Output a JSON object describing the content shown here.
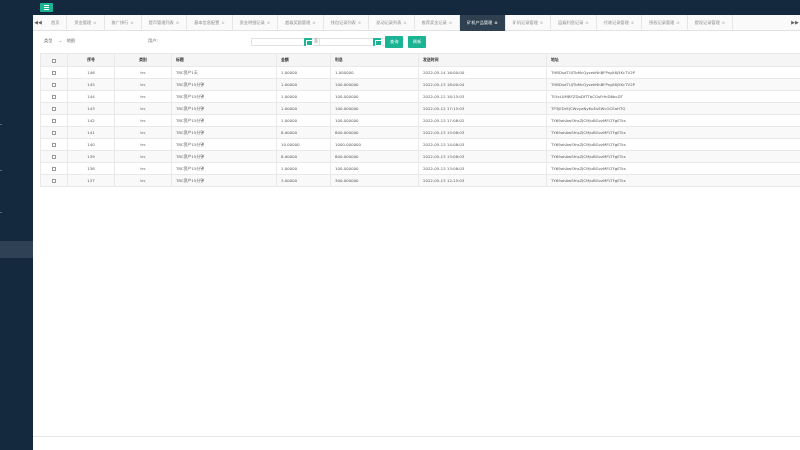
{
  "header": {
    "accent_color": "#1ab394",
    "sidebar_color": "#15293e",
    "active_tab_color": "#2f4050"
  },
  "tabs": [
    "首页",
    "资金管理",
    "推广排行",
    "提币管理列表",
    "基本信息配置",
    "资金明细记录",
    "超级奖励管理",
    "钱包记录列表",
    "发动记录列表",
    "推荐奖金记录",
    "矿机产品管理",
    "矿机记录管理",
    "层级利息记录",
    "代收记录管理",
    "授权记录管理",
    "提现记录管理"
  ],
  "active_tab_index": 10,
  "filter": {
    "type_value": "类型",
    "type_placeholder": "地图",
    "user_label": "用户:",
    "created_label": "创建时间",
    "to_label": "至",
    "search_button": "查询",
    "refresh_button": "刷新"
  },
  "table": {
    "columns": [
      "序号",
      "类别",
      "标题",
      "金额",
      "利息",
      "发送时间",
      "地址"
    ],
    "rows": [
      [
        "146",
        "trc",
        "TRC资产1天",
        "1.00000",
        "1.000000",
        "2022-05-14 16:00:00",
        "THBDsdTUJTbMcQysekNhBFPrgX6j5KcTV2P"
      ],
      [
        "145",
        "trc",
        "TRC资产15分钟",
        "1.00000",
        "100.000000",
        "2022-05-13 18:00:04",
        "THBDsdTUJTbMcQysekNhBFPrgX6j5KcTV2P"
      ],
      [
        "144",
        "trc",
        "TRC资产15分钟",
        "1.00000",
        "100.000000",
        "2022-05-12 18:15:03",
        "TLYxLUMBFZDoDfTTbCGsFrfnD6bcDT"
      ],
      [
        "143",
        "trc",
        "TRC资产15分钟",
        "1.00000",
        "100.000000",
        "2022-05-12 17:15:03",
        "TP3jEDrEJCWvyaNyKuEsSWcGCEaHTG"
      ],
      [
        "142",
        "trc",
        "TRC资产15分钟",
        "1.00000",
        "100.000000",
        "2022-05-13 17:08:02",
        "TY69ohAwSfnsZJCMjuBGvzMFLTFgETcs"
      ],
      [
        "141",
        "trc",
        "TRC资产15分钟",
        "8.00000",
        "800.000000",
        "2022-05-13 15:08:03",
        "TY69ohAwSfnsZJCMjuBGvzMFLTFgETcs"
      ],
      [
        "140",
        "trc",
        "TRC资产15分钟",
        "10.00000",
        "1000.000000",
        "2022-05-13 14:08:03",
        "TY69ohAwSfnsZJCMjuBGvzMFLTFgETcs"
      ],
      [
        "139",
        "trc",
        "TRC资产15分钟",
        "8.00000",
        "800.000000",
        "2022-05-13 13:08:03",
        "TY69ohAwSfnsZJCMjuBGvzMFLTFgETcs"
      ],
      [
        "138",
        "trc",
        "TRC资产15分钟",
        "1.00000",
        "100.000000",
        "2022-05-13 13:08:03",
        "TY69ohAwSfnsZJCMjuBGvzMFLTFgETcs"
      ],
      [
        "137",
        "trc",
        "TRC资产15分钟",
        "3.00000",
        "300.000000",
        "2022-05-13 12:15:03",
        "TY69ohAwSfnsZJCMjuBGvzMFLTFgETcs"
      ]
    ]
  }
}
